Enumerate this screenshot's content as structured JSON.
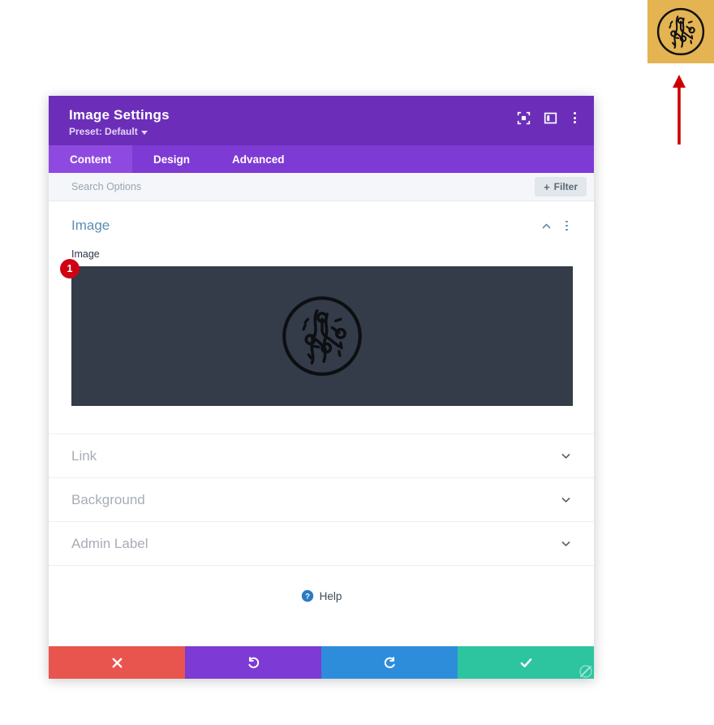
{
  "colors": {
    "header_purple": "#6c2eb9",
    "tabbar_purple": "#7e3ad4",
    "tab_active_purple": "#8e4ae0",
    "section_title_blue": "#5b8db3",
    "preview_bg": "#333c48",
    "badge_red": "#d00014",
    "logo_bg_gold": "#e4b352",
    "cancel_red": "#e8554e",
    "undo_purple": "#7d3ad4",
    "redo_blue": "#2e8ddb",
    "save_green": "#2dc4a0",
    "annotation_red": "#cc0000"
  },
  "corner_logo": {
    "icon": "circuit-circle-logo"
  },
  "annotation": {
    "icon": "up-arrow-annotation"
  },
  "modal": {
    "header": {
      "title": "Image Settings",
      "preset_label": "Preset: Default",
      "icons": [
        {
          "name": "fullscreen-icon"
        },
        {
          "name": "layout-view-icon"
        },
        {
          "name": "more-options-icon"
        }
      ]
    },
    "tabs": [
      {
        "label": "Content",
        "active": true
      },
      {
        "label": "Design",
        "active": false
      },
      {
        "label": "Advanced",
        "active": false
      }
    ],
    "search": {
      "placeholder": "Search Options",
      "value": ""
    },
    "filter_button": {
      "plus": "+",
      "label": "Filter"
    },
    "open_section": {
      "title": "Image",
      "collapse_icon": "chevron-up-icon",
      "menu_icon": "more-options-icon",
      "field_label": "Image",
      "badge": "1",
      "preview_icon": "circuit-circle-logo"
    },
    "collapsed_sections": [
      {
        "title": "Link",
        "icon": "chevron-down-icon"
      },
      {
        "title": "Background",
        "icon": "chevron-down-icon"
      },
      {
        "title": "Admin Label",
        "icon": "chevron-down-icon"
      }
    ],
    "help": {
      "icon": "help-circle-icon",
      "label": "Help"
    },
    "actions": [
      {
        "name": "cancel-button",
        "icon": "close-x-icon"
      },
      {
        "name": "undo-button",
        "icon": "undo-arrow-icon"
      },
      {
        "name": "redo-button",
        "icon": "redo-arrow-icon"
      },
      {
        "name": "save-button",
        "icon": "checkmark-icon"
      }
    ],
    "resize_handle": {
      "icon": "resize-grip-icon"
    }
  }
}
